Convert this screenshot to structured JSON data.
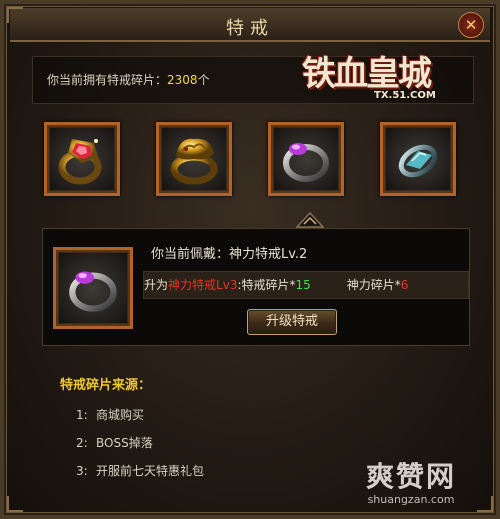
{
  "window": {
    "title": "特戒",
    "close_symbol": "✕"
  },
  "logo": {
    "main": "铁血皇城",
    "sub": "TX.51.COM"
  },
  "fragments": {
    "label": "你当前拥有特戒碎片：",
    "count": "2308",
    "unit": "个"
  },
  "rings": [
    {
      "name": "ruby-gold-ring",
      "gem_color": "#e0253a"
    },
    {
      "name": "dragon-gold-ring",
      "gem_color": "#d8a020"
    },
    {
      "name": "amethyst-silver-ring",
      "gem_color": "#b83ad8"
    },
    {
      "name": "blue-crystal-ring",
      "gem_color": "#5bd0e0"
    }
  ],
  "current": {
    "wearing_label": "你当前佩戴：神力特戒Lv.2",
    "upgrade_prefix": "升为",
    "upgrade_target": "神力特戒Lv",
    "upgrade_level": "3",
    "cost1_label": ":特戒碎片*",
    "cost1_value": "15",
    "cost2_label": "神力碎片*",
    "cost2_value": "6",
    "upgrade_button": "升级特戒"
  },
  "sources": {
    "title": "特戒碎片来源：",
    "items": [
      {
        "num": "1:",
        "text": "商城购买"
      },
      {
        "num": "2:",
        "text": "BOSS掉落"
      },
      {
        "num": "3:",
        "text": "开服前七天特惠礼包"
      }
    ]
  },
  "watermark": {
    "main": "爽赞网",
    "sub": "shuangzan.com"
  },
  "colors": {
    "frame": "#b0632b",
    "highlight": "#f2d84a",
    "red": "#e8342a",
    "green": "#3de04a",
    "title": "#f0c830"
  }
}
